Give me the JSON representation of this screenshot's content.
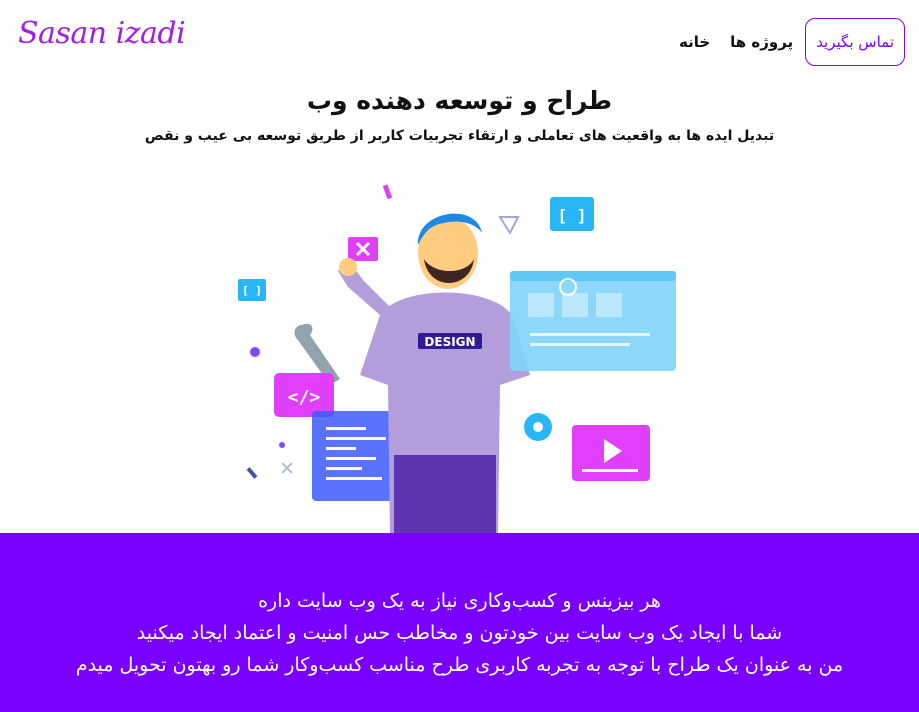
{
  "header": {
    "logo": "Sasan izadi",
    "nav": {
      "contact_label": "تماس بگیرید",
      "projects_label": "پروژه ها",
      "home_label": "خانه"
    }
  },
  "hero": {
    "title": "طراح و توسعه دهنده وب",
    "subtitle": "تبدیل ایده ها به واقعیت های تعاملی و ارتقاء تجربیات کاربر از طریق توسعه بی عیب و نقص",
    "illustration_shirt_text": "DESIGN"
  },
  "about": {
    "lines": [
      "هر بیزینس و کسب‌وکاری نیاز به یک وب سایت داره",
      "شما با ایجاد یک وب سایت بین خودتون و مخاطب حس امنیت و اعتماد ایجاد میکنید",
      "من به عنوان یک طراح با توجه به تجربه کاربری طرح مناسب کسب‌وکار شما رو بهتون تحویل میدم"
    ]
  },
  "colors": {
    "accent": "#7a00ff",
    "logo": "#a01ee8"
  }
}
